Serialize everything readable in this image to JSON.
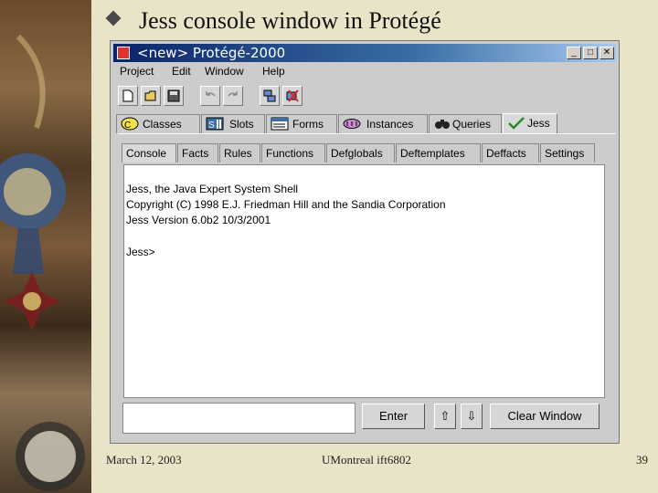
{
  "slide": {
    "title": "Jess console window in Protégé",
    "footer_date": "March 12, 2003",
    "footer_center": "UMontreal ift6802",
    "page_number": "39"
  },
  "window": {
    "title": "<new> Protégé-2000",
    "controls": {
      "minimize": "_",
      "maximize": "□",
      "close": "✕"
    }
  },
  "menu": [
    "Project",
    "Edit",
    "Window",
    "Help"
  ],
  "toolbar_icons": [
    "new-file-icon",
    "open-folder-icon",
    "save-icon",
    "undo-icon",
    "redo-icon",
    "cascade-icon",
    "close-windows-icon"
  ],
  "main_tabs": [
    {
      "label": "Classes",
      "icon": "classes-icon"
    },
    {
      "label": "Slots",
      "icon": "slots-icon"
    },
    {
      "label": "Forms",
      "icon": "forms-icon"
    },
    {
      "label": "Instances",
      "icon": "instances-icon"
    },
    {
      "label": "Queries",
      "icon": "binoculars-icon"
    },
    {
      "label": "Jess",
      "icon": "checkmark-icon",
      "active": true
    }
  ],
  "sub_tabs": [
    "Console",
    "Facts",
    "Rules",
    "Functions",
    "Defglobals",
    "Deftemplates",
    "Deffacts",
    "Settings"
  ],
  "console": {
    "lines": [
      "Jess, the Java Expert System Shell",
      "Copyright (C) 1998 E.J. Friedman Hill and the Sandia Corporation",
      "Jess Version 6.0b2 10/3/2001",
      "",
      "Jess>"
    ],
    "input_value": ""
  },
  "buttons": {
    "enter": "Enter",
    "up": "⇧",
    "down": "⇩",
    "clear": "Clear Window"
  }
}
